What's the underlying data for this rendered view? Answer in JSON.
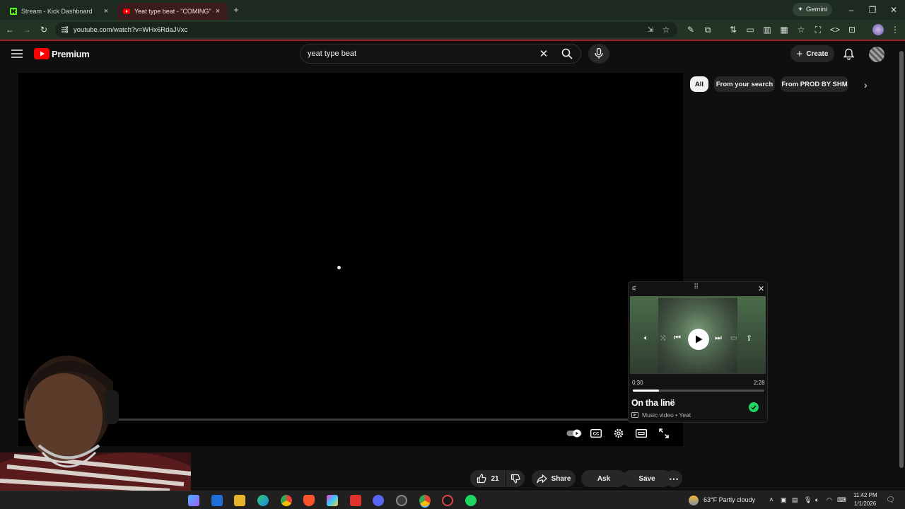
{
  "browser": {
    "tabs": [
      {
        "title": "Stream - Kick Dashboard",
        "active": false
      },
      {
        "title": "Yeat type beat - \"COMING\" - Yo",
        "active": true
      }
    ],
    "new_tab_icon": "plus-icon",
    "gemini_label": "Gemini",
    "url": "youtube.com/watch?v=WHx6RdaJVxc"
  },
  "youtube": {
    "logo_text": "Premium",
    "search_value": "yeat type beat",
    "create_label": "Create",
    "chips": [
      "All",
      "From your search",
      "From PROD BY SHM"
    ],
    "actions": {
      "likes": "21",
      "share_label": "Share",
      "ask_label": "Ask",
      "save_label": "Save"
    },
    "progress": 0
  },
  "mini_player": {
    "time_elapsed": "0:30",
    "time_total": "2:28",
    "progress": 0.2,
    "title": "On tha linë",
    "subtitle": "Music video • Yeat"
  },
  "taskbar": {
    "weather": "63°F  Partly cloudy",
    "time": "11:42 PM",
    "date": "1/1/2026"
  },
  "colors": {
    "youtube_red": "#ff0000",
    "spotify_green": "#1ed760",
    "kick_green": "#53fc18"
  }
}
